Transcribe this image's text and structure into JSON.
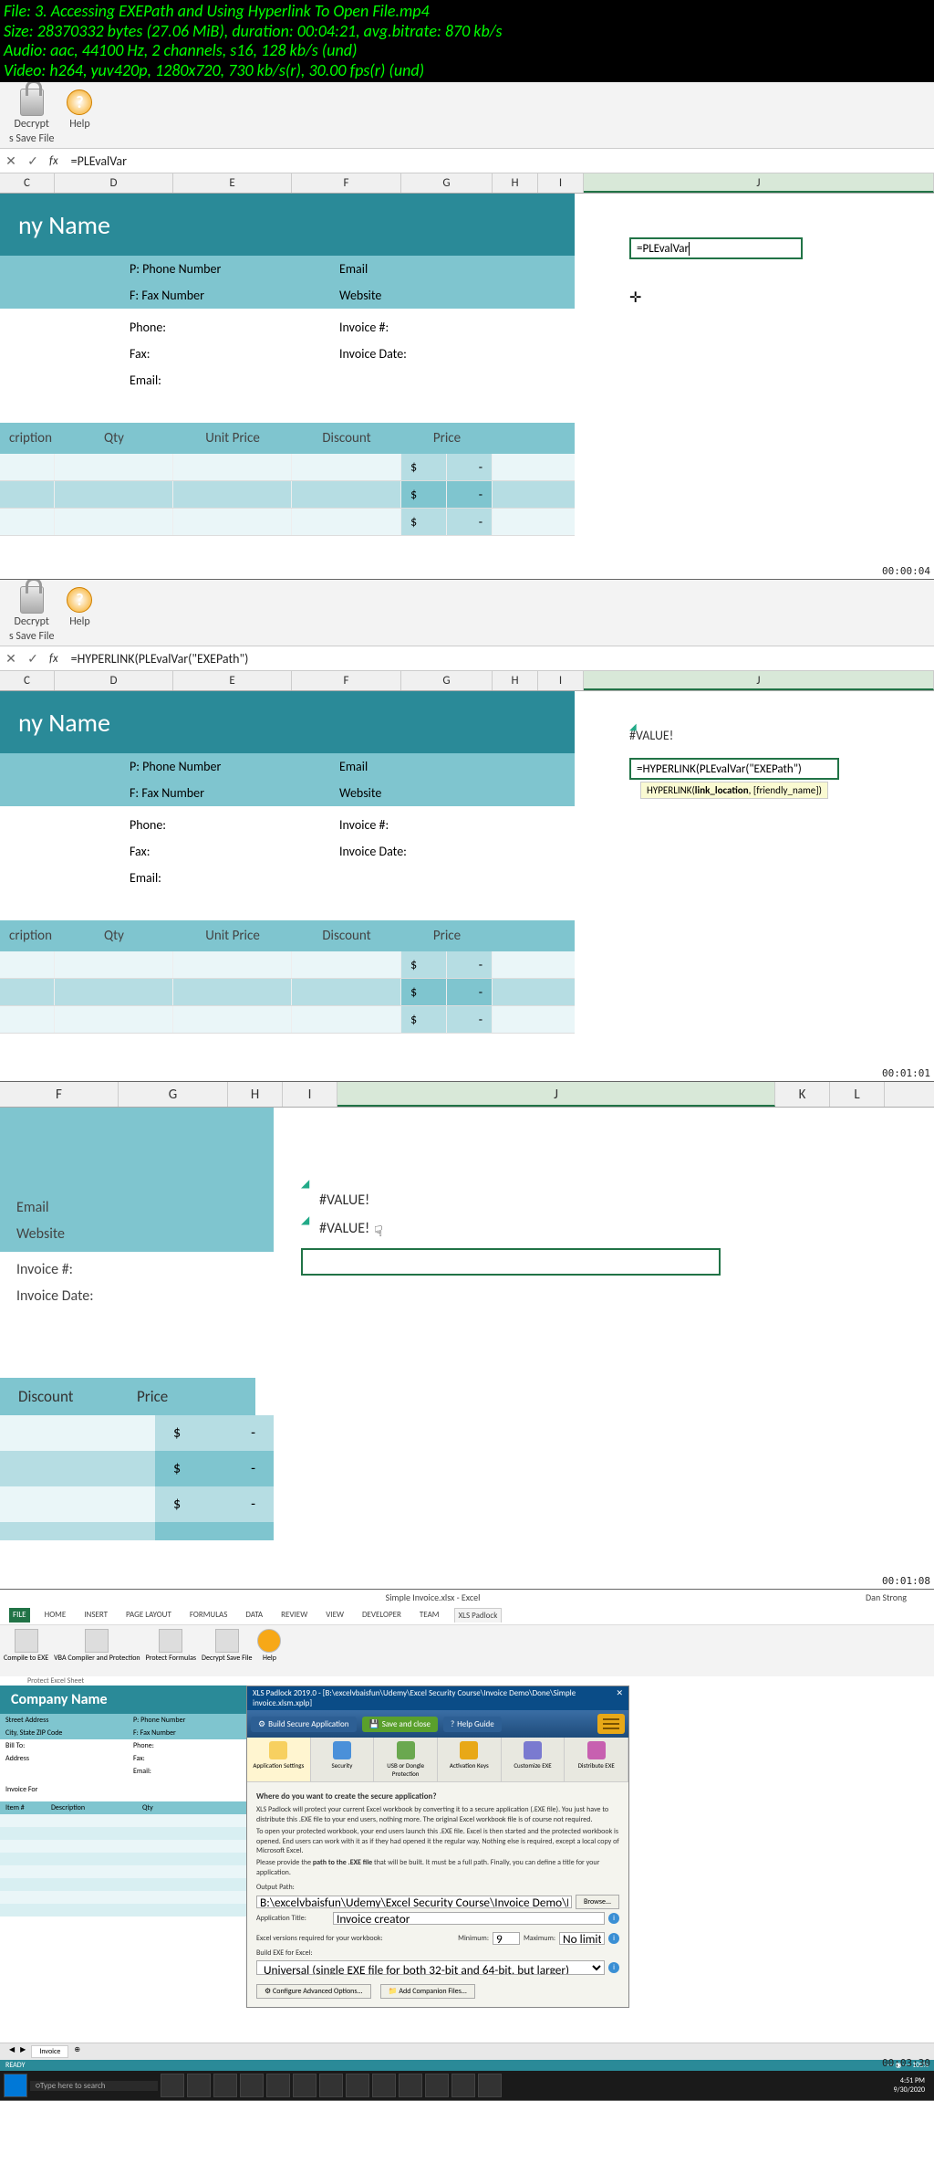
{
  "file_info": {
    "l1": "File: 3. Accessing EXEPath and Using Hyperlink To Open File.mp4",
    "l2": "Size: 28370332 bytes (27.06 MiB), duration: 00:04:21, avg.bitrate: 870 kb/s",
    "l3": "Audio: aac, 44100 Hz, 2 channels, s16, 128 kb/s (und)",
    "l4": "Video: h264, yuv420p, 1280x720, 730 kb/s(r), 30.00 fps(r) (und)"
  },
  "ribbon": {
    "decrypt": "Decrypt",
    "decrypt2": "s Save File",
    "help": "Help"
  },
  "formula": {
    "fx": "fx",
    "s1": "=PLEvalVar",
    "s2": "=HYPERLINK(PLEvalVar(\"EXEPath\")"
  },
  "cols": {
    "C": "C",
    "D": "D",
    "E": "E",
    "F": "F",
    "G": "G",
    "H": "H",
    "I": "I",
    "J": "J",
    "K": "K",
    "L": "L"
  },
  "inv": {
    "title": "ny Name",
    "phone_lbl": "P: Phone Number",
    "fax_lbl": "F: Fax Number",
    "email": "Email",
    "website": "Website",
    "phone2": "Phone:",
    "fax2": "Fax:",
    "email2": "Email:",
    "invno": "Invoice #:",
    "invdate": "Invoice Date:"
  },
  "table": {
    "desc": "cription",
    "qty": "Qty",
    "unit": "Unit Price",
    "disc": "Discount",
    "price": "Price",
    "dollar": "$",
    "dash": "-"
  },
  "s2": {
    "valerr": "#VALUE!",
    "editing": "=HYPERLINK(PLEvalVar(\"EXEPath\")",
    "hint_fn": "HYPERLINK(",
    "hint_b": "link_location",
    "hint_rest": ", [friendly_name])"
  },
  "s3": {
    "valerr1": "#VALUE!",
    "valerr2": "#VALUE!",
    "disc": "Discount",
    "price": "Price"
  },
  "s4": {
    "title": "Simple Invoice.xlsx - Excel",
    "user": "Dan Strong",
    "tabs": {
      "file": "FILE",
      "home": "HOME",
      "insert": "INSERT",
      "pagelayout": "PAGE LAYOUT",
      "formulas": "FORMULAS",
      "data": "DATA",
      "review": "REVIEW",
      "view": "VIEW",
      "developer": "DEVELOPER",
      "team": "TEAM",
      "xls": "XLS Padlock"
    },
    "rg": {
      "compile": "Compile to EXE",
      "vba": "VBA Compiler and Protection",
      "protect": "Protect Formulas",
      "decrypt": "Decrypt Save File",
      "help": "Help",
      "grp": "Protect Excel Sheet"
    },
    "inv_title": "Company Name",
    "rows": {
      "street": "Street Address",
      "phone": "P: Phone Number",
      "city": "City, State ZIP Code",
      "fax": "F: Fax Number",
      "billto": "Bill To:",
      "ph2": "Phone:",
      "addr": "Address",
      "fx2": "Fax:",
      "em2": "Email:",
      "invfor": "Invoice For"
    },
    "thdr": {
      "item": "Item #",
      "desc": "Description",
      "qty": "Qty"
    },
    "dlg": {
      "title": "XLS Padlock 2019.0 - [B:\\excelvbaisfun\\Udemy\\Excel Security Course\\Invoice Demo\\Done\\Simple invoice.xlsm.xplp]",
      "build": "Build Secure Application",
      "save": "Save and close",
      "helpg": "Help Guide",
      "cats": {
        "app": "Application Settings",
        "sec": "Security",
        "usb": "USB or Dongle Protection",
        "act": "Activation Keys",
        "cust": "Customize EXE",
        "dist": "Distribute EXE"
      },
      "q": "Where do you want to create the secure application?",
      "p1": "XLS Padlock will protect your current Excel workbook by converting it to a secure application (.EXE file). You just have to distribute this .EXE file to your end users, nothing more. The original Excel workbook file is of course not required.",
      "p2": "To open your protected workbook, your end users launch this .EXE file. Excel is then started and the protected workbook is opened. End users can work with it as if they had opened it the regular way. Nothing else is required, except a local copy of Microsoft Excel.",
      "p3_a": "Please provide the ",
      "p3_b": "path to the .EXE file",
      "p3_c": " that will be built. It must be a full path. Finally, you can define a title for your application.",
      "output": "Output Path:",
      "outval": "B:\\excelvbaisfun\\Udemy\\Excel Security Course\\Invoice Demo\\Done\\Simple invoice.exe",
      "browse": "Browse...",
      "apptitle": "Application Title:",
      "apptitleval": "Invoice creator",
      "excver": "Excel versions required for your workbook:",
      "min": "Minimum:",
      "max": "Maximum:",
      "nolimit": "No limit",
      "buildexe": "Build EXE for Excel:",
      "buildval": "Universal (single EXE file for both 32-bit and 64-bit, but larger)",
      "advopt": "Configure Advanced Options...",
      "addcomp": "Add Companion Files..."
    },
    "sheet_tab": "Invoice",
    "status": "READY",
    "search": "Type here to search",
    "time": "4:51 PM",
    "date": "9/30/2020"
  },
  "ts": {
    "s1": "00:00:04",
    "s2": "00:01:01",
    "s3": "00:01:08",
    "s4": "00:03:30"
  }
}
